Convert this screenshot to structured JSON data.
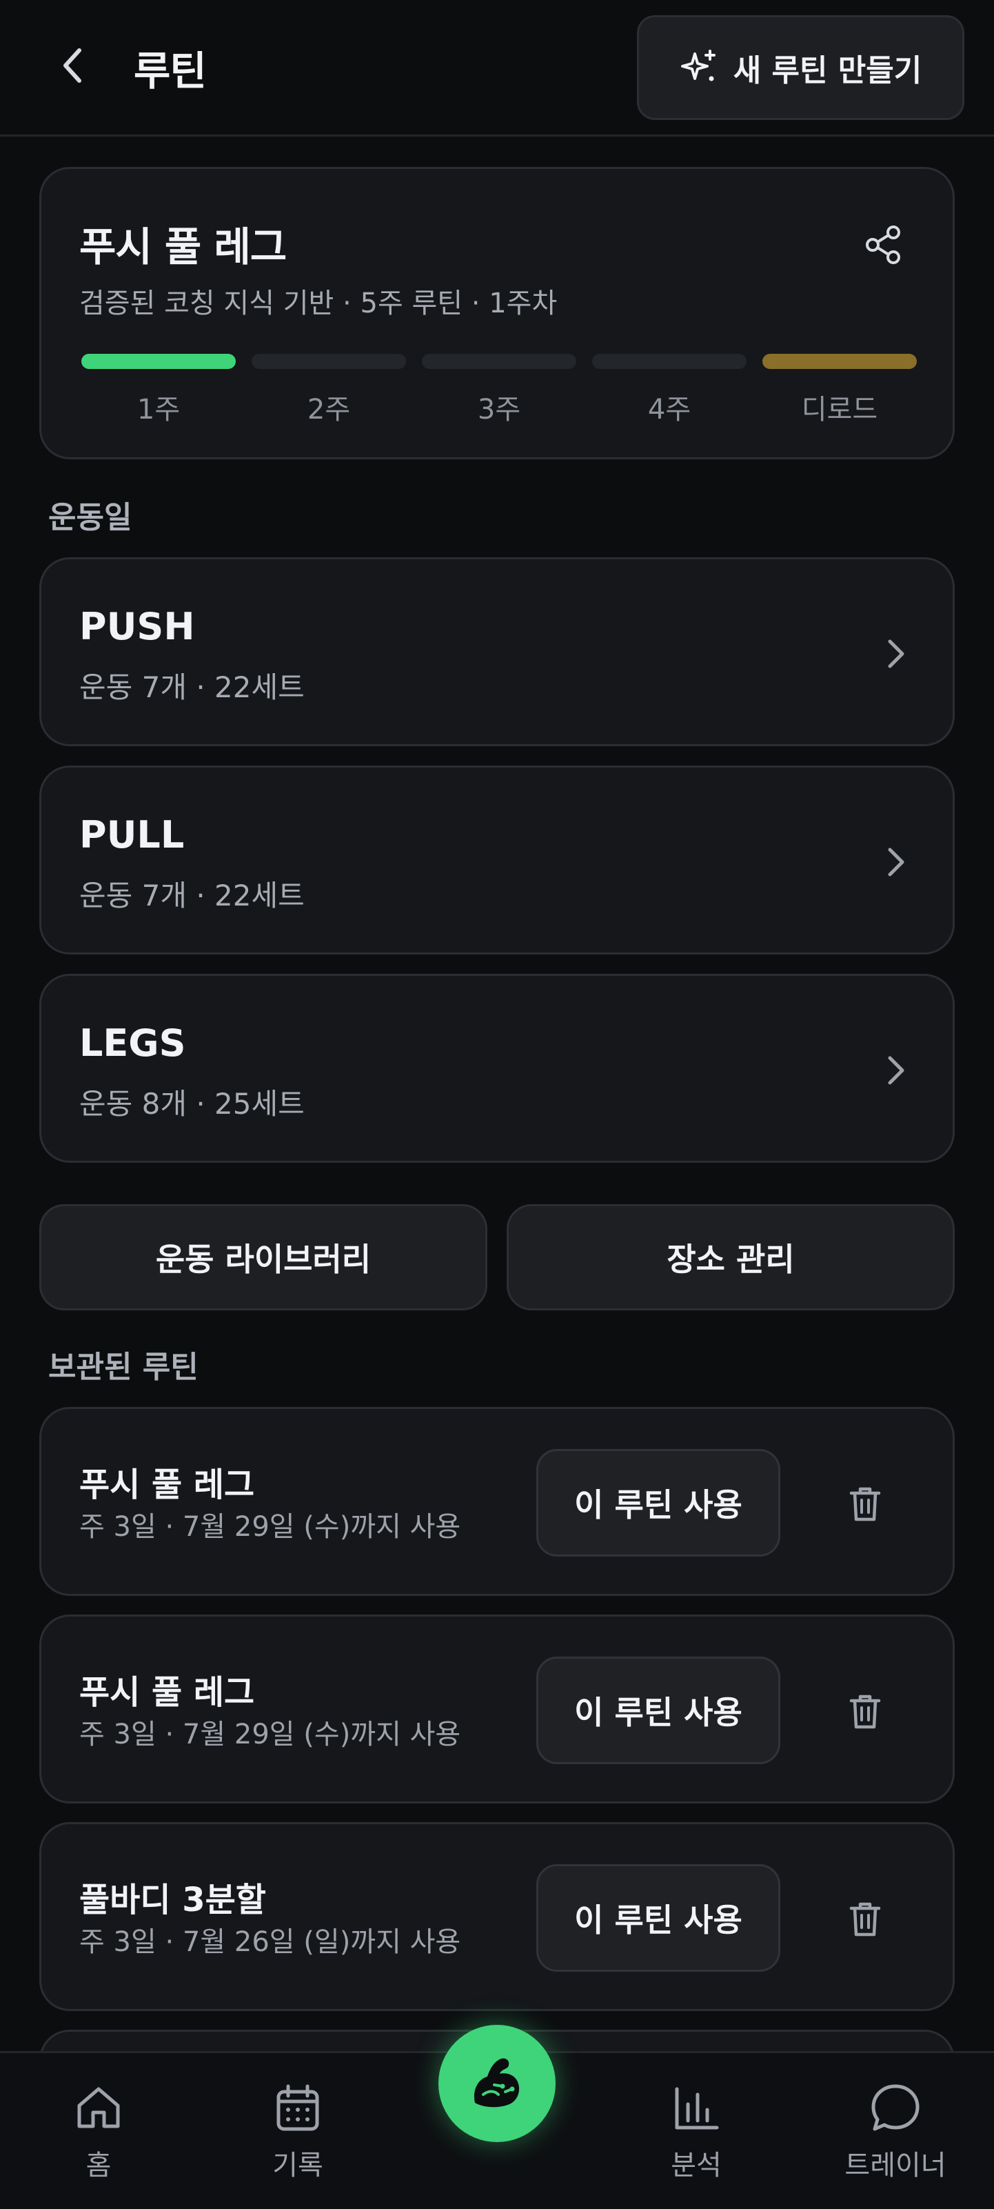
{
  "header": {
    "title": "루틴",
    "new_routine_label": "새 루틴 만들기"
  },
  "program": {
    "title": "푸시 풀 레그",
    "subtitle": "검증된 코칭 지식 기반 · 5주 루틴 · 1주차",
    "weeks": [
      {
        "label": "1주",
        "status": "current",
        "color": "#3fd47a"
      },
      {
        "label": "2주",
        "status": "upcoming",
        "color": "#23262b"
      },
      {
        "label": "3주",
        "status": "upcoming",
        "color": "#23262b"
      },
      {
        "label": "4주",
        "status": "upcoming",
        "color": "#23262b"
      },
      {
        "label": "디로드",
        "status": "deload",
        "color": "#8a6f2a"
      }
    ]
  },
  "workout_days": {
    "section_label": "운동일",
    "items": [
      {
        "name": "PUSH",
        "summary": "운동 7개 · 22세트"
      },
      {
        "name": "PULL",
        "summary": "운동 7개 · 22세트"
      },
      {
        "name": "LEGS",
        "summary": "운동 8개 · 25세트"
      }
    ]
  },
  "utility": {
    "library_label": "운동 라이브러리",
    "places_label": "장소 관리"
  },
  "archived": {
    "section_label": "보관된 루틴",
    "use_label": "이 루틴 사용",
    "items": [
      {
        "name": "푸시 풀 레그",
        "summary": "주 3일 · 7월 29일 (수)까지 사용"
      },
      {
        "name": "푸시 풀 레그",
        "summary": "주 3일 · 7월 29일 (수)까지 사용"
      },
      {
        "name": "풀바디 3분할",
        "summary": "주 3일 · 7월 26일 (일)까지 사용"
      }
    ]
  },
  "nav": {
    "home": "홈",
    "log": "기록",
    "analysis": "분석",
    "trainer": "트레이너"
  },
  "colors": {
    "accent": "#3fd47a",
    "deload": "#8a6f2a",
    "background": "#0c0d0f",
    "card": "#15171a"
  },
  "icons": {
    "back": "chevron-left-icon",
    "new_routine": "sparkles-icon",
    "share": "share-icon",
    "day_chevron": "chevron-right-icon",
    "trash": "trash-icon",
    "home": "home-icon",
    "log": "calendar-icon",
    "center": "flexed-arm-icon",
    "analysis": "bar-chart-icon",
    "trainer": "chat-bubble-icon"
  }
}
